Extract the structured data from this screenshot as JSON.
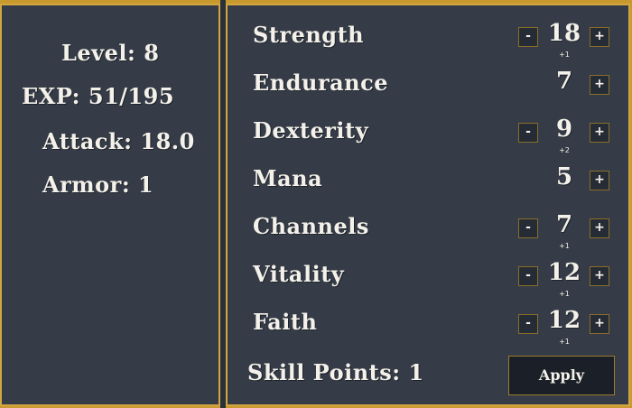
{
  "summary": {
    "level": "Level: 8",
    "exp": "EXP: 51/195",
    "attack": "Attack: 18.0",
    "armor": "Armor: 1"
  },
  "stats": [
    {
      "label": "Strength",
      "value": "18",
      "bonus": "+1",
      "minus": "-",
      "plus": "+"
    },
    {
      "label": "Endurance",
      "value": "7",
      "bonus": "",
      "minus": "",
      "plus": "+"
    },
    {
      "label": "Dexterity",
      "value": "9",
      "bonus": "+2",
      "minus": "-",
      "plus": "+"
    },
    {
      "label": "Mana",
      "value": "5",
      "bonus": "",
      "minus": "",
      "plus": "+"
    },
    {
      "label": "Channels",
      "value": "7",
      "bonus": "+1",
      "minus": "-",
      "plus": "+"
    },
    {
      "label": "Vitality",
      "value": "12",
      "bonus": "+1",
      "minus": "-",
      "plus": "+"
    },
    {
      "label": "Faith",
      "value": "12",
      "bonus": "+1",
      "minus": "-",
      "plus": "+"
    }
  ],
  "footer": {
    "skill_points": "Skill Points: 1",
    "apply_label": "Apply"
  },
  "colors": {
    "panel_bg": "#353c47",
    "border_gold": "#d3a540",
    "text": "#f4f1ea"
  }
}
